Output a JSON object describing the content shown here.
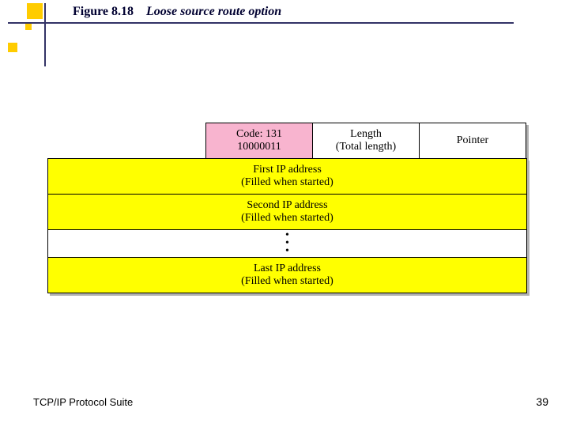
{
  "title": {
    "figure": "Figure 8.18",
    "caption": "Loose source route option"
  },
  "header": {
    "code": {
      "line1": "Code: 131",
      "line2": "10000011"
    },
    "length": {
      "line1": "Length",
      "line2": "(Total length)"
    },
    "pointer": {
      "line1": "Pointer"
    }
  },
  "rows": {
    "first": {
      "line1": "First IP address",
      "line2": "(Filled when started)"
    },
    "second": {
      "line1": "Second IP address",
      "line2": "(Filled when started)"
    },
    "last": {
      "line1": "Last IP address",
      "line2": "(Filled when started)"
    }
  },
  "footer": {
    "left": "TCP/IP Protocol Suite",
    "right": "39"
  },
  "colors": {
    "code_bg": "#f8b4cf",
    "row_bg": "#ffff00",
    "accent": "#333366",
    "deco": "#ffcc00"
  }
}
